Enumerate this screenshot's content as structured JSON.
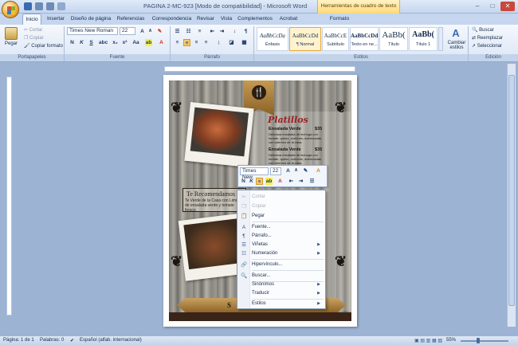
{
  "window": {
    "title": "PAGINA 2-MC-923 [Modo de compatibilidad] - Microsoft Word",
    "context_tab_group": "Herramientas de cuadro de texto",
    "controls": [
      "–",
      "□",
      "✕"
    ]
  },
  "tabs": [
    "Inicio",
    "Insertar",
    "Diseño de página",
    "Referencias",
    "Correspondencia",
    "Revisar",
    "Vista",
    "Complementos",
    "Acrobat",
    "Formato"
  ],
  "ribbon": {
    "clipboard": {
      "paste": "Pegar",
      "cut": "Cortar",
      "copy": "Copiar",
      "format_painter": "Copiar formato",
      "label": "Portapapeles"
    },
    "font": {
      "name": "Times New Roman",
      "size": "22",
      "label": "Fuente",
      "bold": "N",
      "italic": "K",
      "underline": "S"
    },
    "paragraph": {
      "label": "Párrafo"
    },
    "styles": {
      "label": "Estilos",
      "items": [
        {
          "sample": "AaBbCcDa",
          "name": "Énfasis"
        },
        {
          "sample": "AaBbCcDd",
          "name": "¶ Normal"
        },
        {
          "sample": "AaBbCcE",
          "name": "Subtítulo"
        },
        {
          "sample": "AaBbCcDd",
          "name": "Texto en ne..."
        },
        {
          "sample": "AaBb(",
          "name": "Título"
        },
        {
          "sample": "AaBb(",
          "name": "Título 1"
        }
      ],
      "change_styles": "Cambiar estilos"
    },
    "editing": {
      "find": "Buscar",
      "replace": "Reemplazar",
      "select": "Seleccionar",
      "label": "Edición"
    }
  },
  "document": {
    "menu_title": "Platillos",
    "dishes": [
      {
        "name": "Ensalada Verde",
        "price": "$35",
        "desc": "Deliciosa ensalada de lechuga con tomate, queso, crotones, aderezadas con aderezo de la casa."
      },
      {
        "name": "Ensalada Verde",
        "price": "$35",
        "desc": "Deliciosa ensalada de lechuga con tomate, queso, crotones, aderezadas con aderezo de la casa."
      }
    ],
    "recommend_title": "Te Recomendamos",
    "recommend_body": "Te Verde de la Casa con Limón de ensalada verde y tomate fresco",
    "footer_text": "S"
  },
  "mini_toolbar": {
    "font": "Times New",
    "size": "22"
  },
  "context_menu": [
    {
      "label": "Cortar",
      "icon": "✂",
      "disabled": true,
      "submenu": false
    },
    {
      "label": "Copiar",
      "icon": "❐",
      "disabled": true,
      "submenu": false
    },
    {
      "label": "Pegar",
      "icon": "📋",
      "disabled": false,
      "submenu": false,
      "sep_after": true
    },
    {
      "label": "Fuente...",
      "icon": "A",
      "disabled": false,
      "submenu": false
    },
    {
      "label": "Párrafo...",
      "icon": "¶",
      "disabled": false,
      "submenu": false
    },
    {
      "label": "Viñetas",
      "icon": "☰",
      "disabled": false,
      "submenu": true
    },
    {
      "label": "Numeración",
      "icon": "☷",
      "disabled": false,
      "submenu": true,
      "sep_after": true
    },
    {
      "label": "Hipervínculo...",
      "icon": "🔗",
      "disabled": false,
      "submenu": false,
      "sep_after": true
    },
    {
      "label": "Buscar...",
      "icon": "🔍",
      "disabled": false,
      "submenu": false,
      "sep_after": true
    },
    {
      "label": "Sinónimos",
      "icon": "",
      "disabled": false,
      "submenu": true
    },
    {
      "label": "Traducir",
      "icon": "",
      "disabled": false,
      "submenu": true,
      "sep_after": true
    },
    {
      "label": "Estilos",
      "icon": "",
      "disabled": false,
      "submenu": true
    }
  ],
  "status": {
    "page": "Página: 1 de 1",
    "words": "Palabras: 0",
    "language": "Español (alfab. internacional)",
    "zoom": "55%"
  },
  "colors": {
    "accent": "#e6a93c",
    "title_red": "#9b1f1f",
    "ribbon_bg": "#dbe6f4"
  }
}
